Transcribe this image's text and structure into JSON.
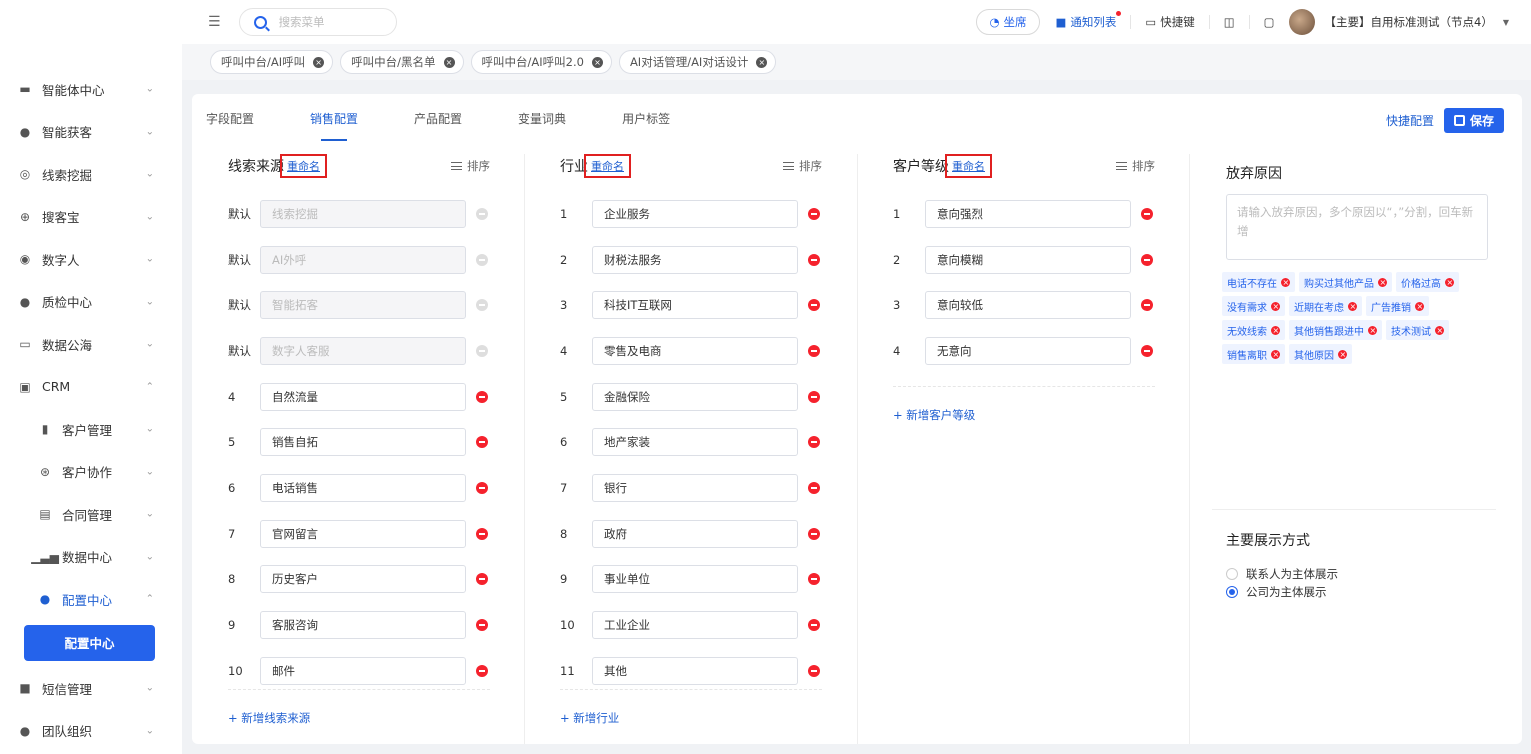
{
  "search": {
    "placeholder": "搜索菜单"
  },
  "topbar": {
    "seat": "坐席",
    "notice": "通知列表",
    "shortcut": "快捷键",
    "user": "【主要】自用标准测试（节点4）"
  },
  "page_tabs": [
    "呼叫中台/AI呼叫",
    "呼叫中台/黑名单",
    "呼叫中台/AI呼叫2.0",
    "AI对话管理/AI对话设计"
  ],
  "sidebar": {
    "items": [
      {
        "label": "智能体中心"
      },
      {
        "label": "智能获客"
      },
      {
        "label": "线索挖掘"
      },
      {
        "label": "搜客宝"
      },
      {
        "label": "数字人"
      },
      {
        "label": "质检中心"
      },
      {
        "label": "数据公海"
      },
      {
        "label": "CRM"
      }
    ],
    "crm_children": [
      {
        "label": "客户管理"
      },
      {
        "label": "客户协作"
      },
      {
        "label": "合同管理"
      },
      {
        "label": "数据中心"
      },
      {
        "label": "配置中心"
      }
    ],
    "active_leaf": "配置中心",
    "tail_items": [
      {
        "label": "短信管理"
      },
      {
        "label": "团队组织"
      }
    ]
  },
  "config_tabs": [
    "字段配置",
    "销售配置",
    "产品配置",
    "变量词典",
    "用户标签"
  ],
  "actions": {
    "quick": "快捷配置",
    "save": "保存"
  },
  "columns": {
    "lead_source": {
      "title": "线索来源",
      "rename": "重命名",
      "sort": "排序",
      "rows": [
        {
          "idx": "默认",
          "value": "线索挖掘",
          "disabled": true
        },
        {
          "idx": "默认",
          "value": "AI外呼",
          "disabled": true
        },
        {
          "idx": "默认",
          "value": "智能拓客",
          "disabled": true
        },
        {
          "idx": "默认",
          "value": "数字人客服",
          "disabled": true
        },
        {
          "idx": "4",
          "value": "自然流量"
        },
        {
          "idx": "5",
          "value": "销售自拓"
        },
        {
          "idx": "6",
          "value": "电话销售"
        },
        {
          "idx": "7",
          "value": "官网留言"
        },
        {
          "idx": "8",
          "value": "历史客户"
        },
        {
          "idx": "9",
          "value": "客服咨询"
        },
        {
          "idx": "10",
          "value": "邮件"
        }
      ],
      "add": "+ 新增线索来源"
    },
    "industry": {
      "title": "行业",
      "rename": "重命名",
      "sort": "排序",
      "rows": [
        {
          "idx": "1",
          "value": "企业服务"
        },
        {
          "idx": "2",
          "value": "财税法服务"
        },
        {
          "idx": "3",
          "value": "科技IT互联网"
        },
        {
          "idx": "4",
          "value": "零售及电商"
        },
        {
          "idx": "5",
          "value": "金融保险"
        },
        {
          "idx": "6",
          "value": "地产家装"
        },
        {
          "idx": "7",
          "value": "银行"
        },
        {
          "idx": "8",
          "value": "政府"
        },
        {
          "idx": "9",
          "value": "事业单位"
        },
        {
          "idx": "10",
          "value": "工业企业"
        },
        {
          "idx": "11",
          "value": "其他"
        }
      ],
      "add": "+ 新增行业"
    },
    "customer_level": {
      "title": "客户等级",
      "rename": "重命名",
      "sort": "排序",
      "rows": [
        {
          "idx": "1",
          "value": "意向强烈"
        },
        {
          "idx": "2",
          "value": "意向模糊"
        },
        {
          "idx": "3",
          "value": "意向较低"
        },
        {
          "idx": "4",
          "value": "无意向"
        }
      ],
      "add": "+ 新增客户等级"
    }
  },
  "abandon": {
    "title": "放弃原因",
    "placeholder": "请输入放弃原因，多个原因以“，”分割，回车新增",
    "tags": [
      "电话不存在",
      "购买过其他产品",
      "价格过高",
      "没有需求",
      "近期在考虑",
      "广告推销",
      "无效线索",
      "其他销售跟进中",
      "技术测试",
      "销售离职",
      "其他原因"
    ]
  },
  "display": {
    "title": "主要展示方式",
    "options": [
      {
        "label": "联系人为主体展示",
        "selected": false
      },
      {
        "label": "公司为主体展示",
        "selected": true
      }
    ]
  },
  "colors": {
    "primary": "#2563eb",
    "danger": "#f5222d",
    "highlight": "#e02020"
  }
}
